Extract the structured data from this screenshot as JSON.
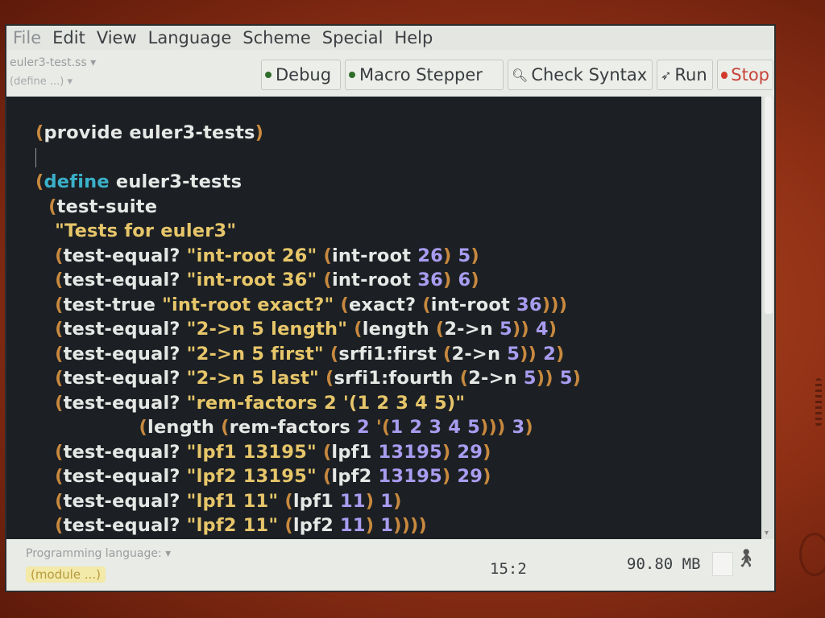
{
  "menu": [
    "File",
    "Edit",
    "View",
    "Language",
    "Scheme",
    "Special",
    "Help"
  ],
  "toolbar": {
    "filename": "euler3-test.ss",
    "define_popup": "(define ...)",
    "debug_label": "Debug",
    "macro_label": "Macro Stepper",
    "check_label": "Check Syntax",
    "run_label": "Run",
    "stop_label": "Stop",
    "icons": {
      "debug": "green-dot-icon",
      "macro": "green-dot-icon",
      "check": "magnifier-icon",
      "run": "runner-icon",
      "stop": "red-dot-icon"
    }
  },
  "code_lines": [
    "(provide euler3-tests)",
    "",
    "(define euler3-tests",
    "  (test-suite",
    "   \"Tests for euler3\"",
    "   (test-equal? \"int-root 26\" (int-root 26) 5)",
    "   (test-equal? \"int-root 36\" (int-root 36) 6)",
    "   (test-true \"int-root exact?\" (exact? (int-root 36)))",
    "   (test-equal? \"2->n 5 length\" (length (2->n 5)) 4)",
    "   (test-equal? \"2->n 5 first\" (srfi1:first (2->n 5)) 2)",
    "   (test-equal? \"2->n 5 last\" (srfi1:fourth (2->n 5)) 5)",
    "   (test-equal? \"rem-factors 2 '(1 2 3 4 5)\"",
    "                (length (rem-factors 2 '(1 2 3 4 5))) 3)",
    "   (test-equal? \"lpf1 13195\" (lpf1 13195) 29)",
    "   (test-equal? \"lpf2 13195\" (lpf2 13195) 29)",
    "   (test-equal? \"lpf1 11\" (lpf1 11) 1)",
    "   (test-equal? \"lpf2 11\" (lpf2 11) 1))))"
  ],
  "status": {
    "language_label": "Programming language:",
    "language_value": "(module ...)",
    "cursor_position": "15:2",
    "memory": "90.80 MB"
  },
  "colors": {
    "editor_bg": "#1c2024",
    "paren": "#c8893f",
    "keyword": "#3bb0c9",
    "string": "#e7c66a",
    "number": "#a99cf0",
    "identifier": "#e6e8e6"
  }
}
